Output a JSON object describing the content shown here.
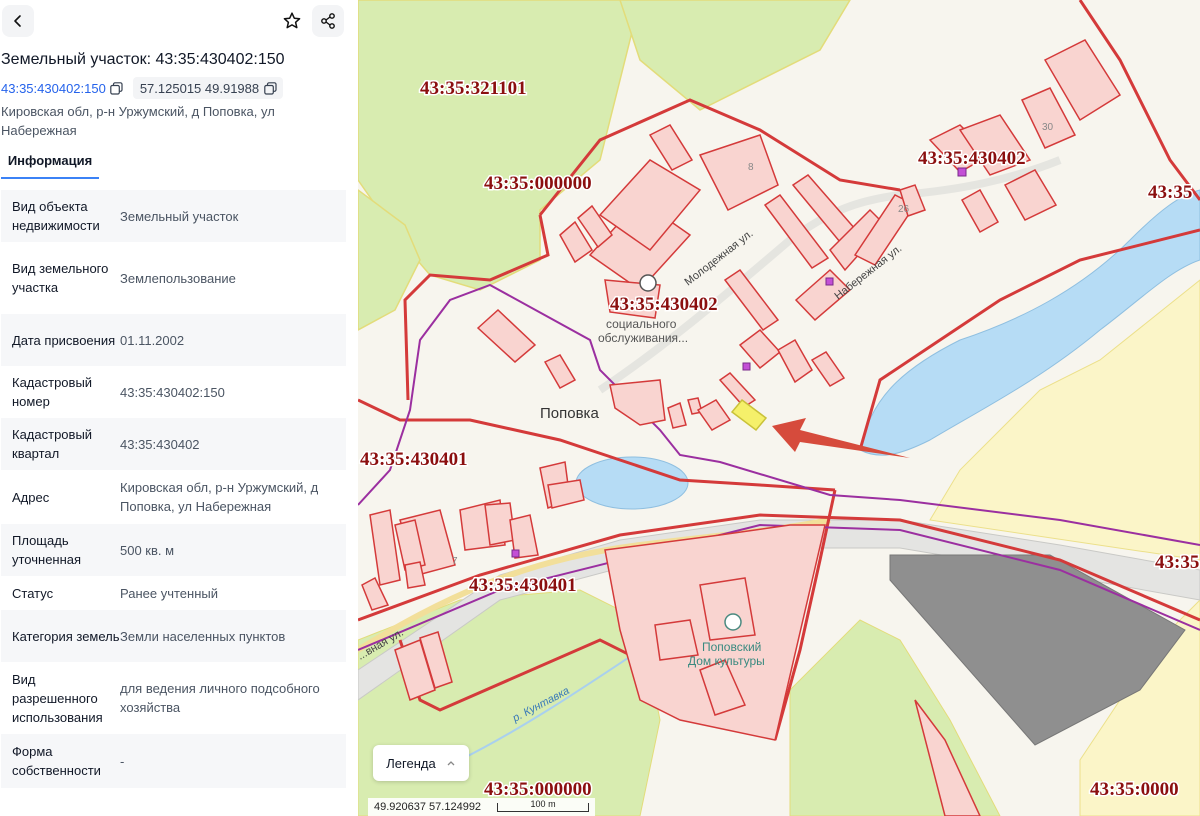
{
  "panel": {
    "title": "Земельный участок: 43:35:430402:150",
    "cadastral_link": "43:35:430402:150",
    "coordinates_chip": "57.125015 49.91988",
    "address": "Кировская обл, р-н Уржумский, д Поповка, ул Набережная",
    "tab_label": "Информация",
    "icons": {
      "back": "chevron-left-icon",
      "favorite": "star-icon",
      "share": "share-icon",
      "copy": "copy-icon"
    },
    "rows": [
      {
        "k": "Вид объекта недвижимости",
        "v": "Земельный участок"
      },
      {
        "k": "Вид земельного участка",
        "v": "Землепользование"
      },
      {
        "k": "Дата присвоения",
        "v": "01.11.2002"
      },
      {
        "k": "Кадастровый номер",
        "v": "43:35:430402:150"
      },
      {
        "k": "Кадастровый квартал",
        "v": "43:35:430402"
      },
      {
        "k": "Адрес",
        "v": "Кировская обл, р-н Уржумский, д Поповка, ул Набережная"
      },
      {
        "k": "Площадь уточненная",
        "v": "500 кв. м"
      },
      {
        "k": "Статус",
        "v": "Ранее учтенный"
      },
      {
        "k": "Категория земель",
        "v": "Земли населенных пунктов"
      },
      {
        "k": "Вид разрешенного использования",
        "v": "для ведения личного подсобного хозяйства"
      },
      {
        "k": "Форма собственности",
        "v": "-"
      }
    ]
  },
  "map": {
    "labels": {
      "q321101": "43:35:321101",
      "q000000_a": "43:35:000000",
      "q430402_a": "43:35:430402",
      "q430402_b": "43:35:430402",
      "q430401_a": "43:35:430401",
      "q430401_b": "43:35:430401",
      "q000000_b": "43:35:000000",
      "edge_a": "43:35",
      "edge_b": "43:35",
      "edge_c": "43:35:0000",
      "village": "Поповка",
      "street_molodezhnaya": "Молодежная ул.",
      "street_naberezhnaya": "Набережная ул.",
      "street_partial": "...вная ул.",
      "river": "р. Кунтавка",
      "social_1": "социального",
      "social_2": "обслуживания...",
      "culture_1": "Поповский",
      "culture_2": "Дом культуры",
      "house_8": "8",
      "house_30": "30",
      "house_26": "26",
      "house_7": "7"
    },
    "legend_label": "Легенда",
    "coords_text": "49.920637  57.124992",
    "scale_label": "100 m",
    "colors": {
      "parcel_border": "#d43a3a",
      "parcel_fill": "#f9d4d0",
      "highlight": "#f5f06a",
      "water": "#b6dcf5",
      "field_green": "#d8ecb0",
      "field_yellow": "#fbf5c8",
      "boundary_purple": "#9b2fa0",
      "arrow": "#d64b3c"
    }
  }
}
